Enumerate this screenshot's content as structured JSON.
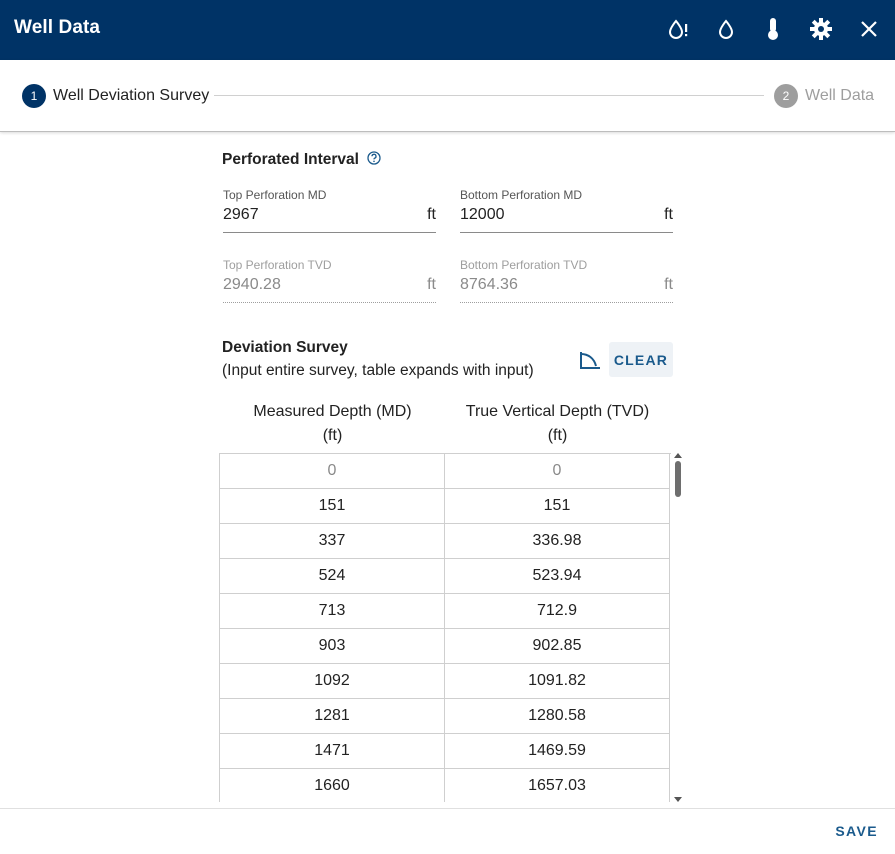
{
  "header": {
    "title": "Well Data",
    "icons": [
      "drop-alert-icon",
      "drop-icon",
      "thermometer-icon",
      "gear-icon",
      "close-icon"
    ]
  },
  "stepper": {
    "steps": [
      {
        "number": "1",
        "label": "Well Deviation Survey",
        "active": true
      },
      {
        "number": "2",
        "label": "Well Data",
        "active": false
      }
    ]
  },
  "perforated_interval": {
    "title": "Perforated Interval",
    "top_md": {
      "label": "Top Perforation MD",
      "value": "2967",
      "unit": "ft"
    },
    "bottom_md": {
      "label": "Bottom Perforation MD",
      "value": "12000",
      "unit": "ft"
    },
    "top_tvd": {
      "label": "Top Perforation TVD",
      "value": "2940.28",
      "unit": "ft"
    },
    "bottom_tvd": {
      "label": "Bottom Perforation TVD",
      "value": "8764.36",
      "unit": "ft"
    }
  },
  "deviation_survey": {
    "title": "Deviation Survey",
    "subtitle": "(Input entire survey, table expands with input)",
    "clear_label": "CLEAR",
    "columns": [
      {
        "line1": "Measured Depth (MD)",
        "line2": "(ft)"
      },
      {
        "line1": "True Vertical Depth (TVD)",
        "line2": "(ft)"
      }
    ],
    "rows": [
      [
        "0",
        "0"
      ],
      [
        "151",
        "151"
      ],
      [
        "337",
        "336.98"
      ],
      [
        "524",
        "523.94"
      ],
      [
        "713",
        "712.9"
      ],
      [
        "903",
        "902.85"
      ],
      [
        "1092",
        "1091.82"
      ],
      [
        "1281",
        "1280.58"
      ],
      [
        "1471",
        "1469.59"
      ],
      [
        "1660",
        "1657.03"
      ]
    ]
  },
  "footer": {
    "save_label": "SAVE"
  },
  "colors": {
    "header_bg": "#003366",
    "accent": "#1a5a8c",
    "inactive": "#9e9e9e"
  }
}
